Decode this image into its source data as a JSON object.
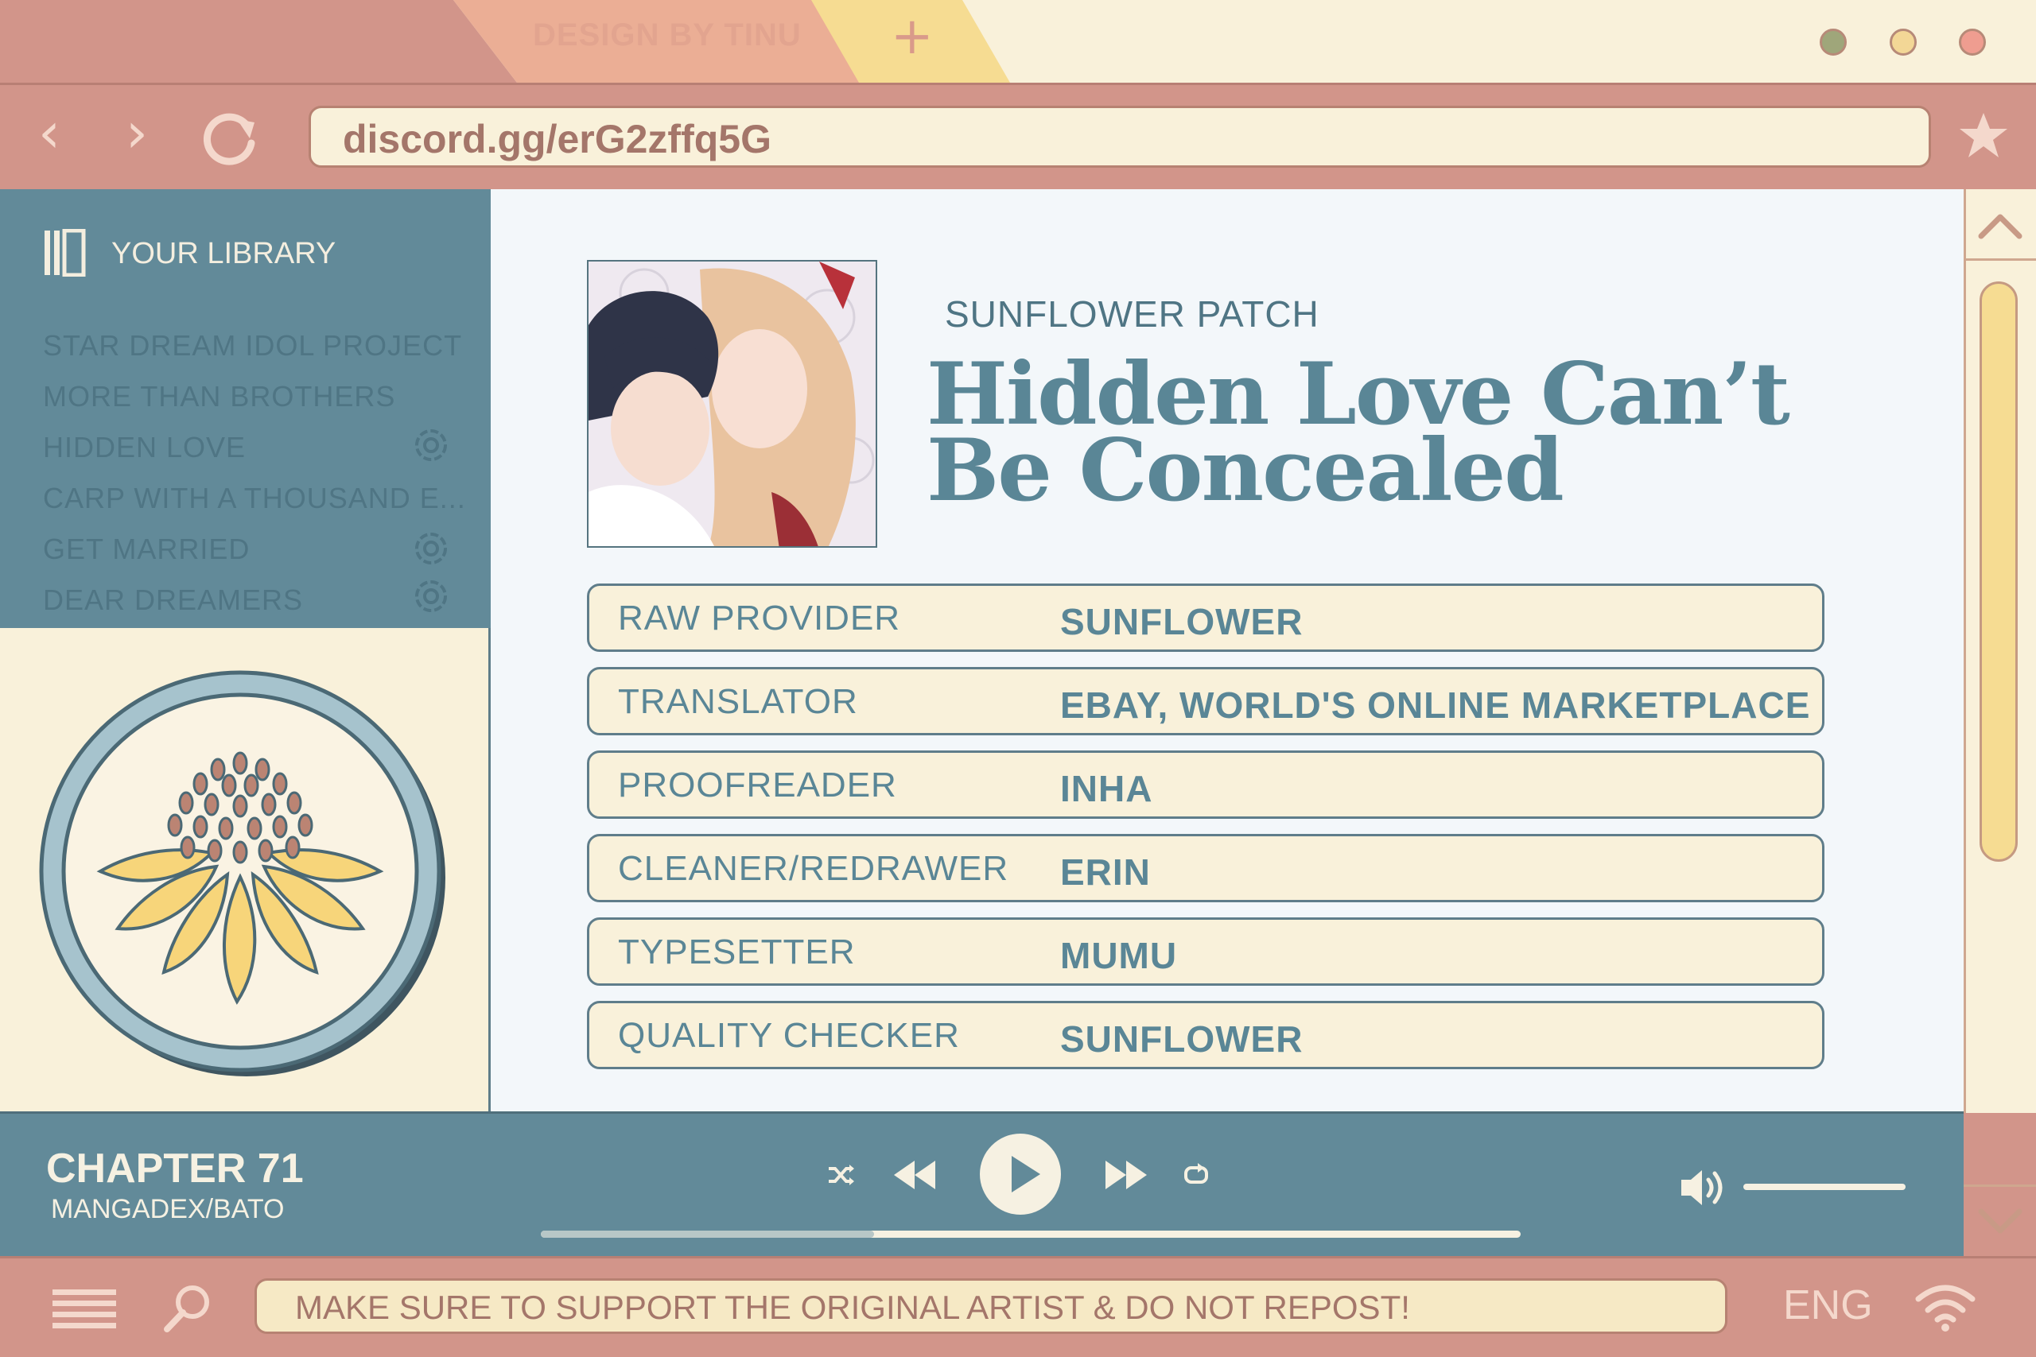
{
  "browser": {
    "tab_label": "DESIGN BY TINU",
    "new_tab_symbol": "+",
    "url": "discord.gg/erG2zffq5G",
    "window_dots": [
      "#9fa67a",
      "#f3d796",
      "#ef9d90"
    ],
    "icons": [
      "back-icon",
      "forward-icon",
      "reload-icon",
      "star-icon"
    ]
  },
  "sidebar": {
    "title": "YOUR LIBRARY",
    "items": [
      {
        "label": "STAR DREAM IDOL PROJECT",
        "flower": false
      },
      {
        "label": "MORE THAN BROTHERS",
        "flower": false
      },
      {
        "label": "HIDDEN LOVE",
        "flower": true
      },
      {
        "label": "CARP WITH A THOUSAND E...",
        "flower": false
      },
      {
        "label": "GET MARRIED",
        "flower": true
      },
      {
        "label": "DEAR DREAMERS",
        "flower": true
      }
    ]
  },
  "main": {
    "group": "SUNFLOWER PATCH",
    "title": "Hidden Love Can’t Be Concealed",
    "credits": [
      {
        "role": "RAW PROVIDER",
        "name": "SUNFLOWER"
      },
      {
        "role": "TRANSLATOR",
        "name": "EBAY, WORLD'S ONLINE MARKETPLACE"
      },
      {
        "role": "PROOFREADER",
        "name": "INHA"
      },
      {
        "role": "CLEANER/REDRAWER",
        "name": "ERIN"
      },
      {
        "role": "TYPESETTER",
        "name": "MUMU"
      },
      {
        "role": "QUALITY CHECKER",
        "name": "SUNFLOWER"
      }
    ]
  },
  "player": {
    "chapter": "CHAPTER 71",
    "source": "MANGADEX/BATO",
    "progress": 0.34,
    "volume": 1.0
  },
  "status": {
    "notice": "MAKE SURE TO SUPPORT THE ORIGINAL ARTIST & DO NOT REPOST!",
    "language": "ENG"
  },
  "colors": {
    "rose": "#d2958a",
    "cream": "#f9f1da",
    "teal": "#628a99",
    "yellow": "#f6dc92"
  }
}
